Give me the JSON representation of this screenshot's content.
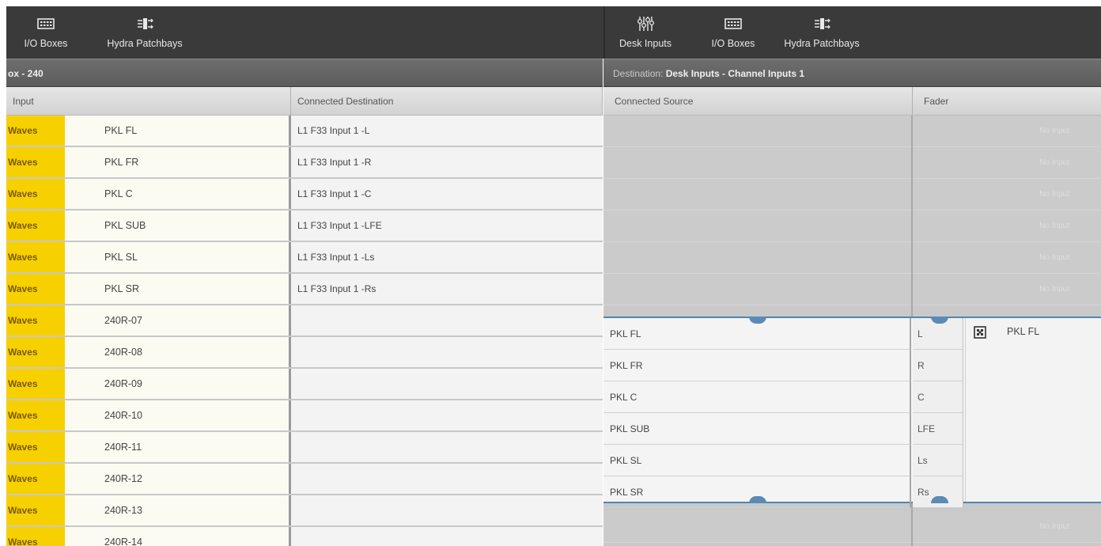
{
  "toolbar": {
    "left": {
      "io_boxes": {
        "label": "I/O Boxes",
        "icon": "io-box-icon"
      },
      "hydra_patchbays": {
        "label": "Hydra Patchbays",
        "icon": "patchbay-icon"
      }
    },
    "right": {
      "desk_inputs": {
        "label": "Desk Inputs",
        "icon": "faders-icon"
      },
      "io_boxes": {
        "label": "I/O Boxes",
        "icon": "io-box-icon"
      },
      "hydra_patchbays": {
        "label": "Hydra Patchbays",
        "icon": "patchbay-icon"
      }
    }
  },
  "source_panel": {
    "title": "ox - 240",
    "headers": {
      "input": "Input",
      "connected_destination": "Connected Destination"
    },
    "rows": [
      {
        "tag": "Waves",
        "input": "PKL FL",
        "destination": "L1 F33 Input 1 -L"
      },
      {
        "tag": "Waves",
        "input": "PKL FR",
        "destination": "L1 F33 Input 1 -R"
      },
      {
        "tag": "Waves",
        "input": "PKL C",
        "destination": "L1 F33 Input 1 -C"
      },
      {
        "tag": "Waves",
        "input": "PKL SUB",
        "destination": "L1 F33 Input 1 -LFE"
      },
      {
        "tag": "Waves",
        "input": "PKL SL",
        "destination": "L1 F33 Input 1 -Ls"
      },
      {
        "tag": "Waves",
        "input": "PKL SR",
        "destination": "L1 F33 Input 1 -Rs"
      },
      {
        "tag": "Waves",
        "input": "240R-07",
        "destination": ""
      },
      {
        "tag": "Waves",
        "input": "240R-08",
        "destination": ""
      },
      {
        "tag": "Waves",
        "input": "240R-09",
        "destination": ""
      },
      {
        "tag": "Waves",
        "input": "240R-10",
        "destination": ""
      },
      {
        "tag": "Waves",
        "input": "240R-11",
        "destination": ""
      },
      {
        "tag": "Waves",
        "input": "240R-12",
        "destination": ""
      },
      {
        "tag": "Waves",
        "input": "240R-13",
        "destination": ""
      },
      {
        "tag": "Waves",
        "input": "240R-14",
        "destination": ""
      }
    ]
  },
  "destination_panel": {
    "title_prefix": "Destination: ",
    "title": "Desk Inputs - Channel Inputs 1",
    "headers": {
      "connected_source": "Connected Source",
      "fader": "Fader"
    },
    "ghost_fader_text": "No Input",
    "active_rows": [
      {
        "source": "PKL FL",
        "leg": "L"
      },
      {
        "source": "PKL FR",
        "leg": "R"
      },
      {
        "source": "PKL C",
        "leg": "C"
      },
      {
        "source": "PKL SUB",
        "leg": "LFE"
      },
      {
        "source": "PKL SL",
        "leg": "Ls"
      },
      {
        "source": "PKL SR",
        "leg": "Rs"
      }
    ],
    "active_fader": {
      "name": "PKL FL",
      "icon": "multichannel-icon"
    }
  },
  "colors": {
    "waves_tag": "#f7d000",
    "selection_border": "#4f86b4",
    "toolbar_bg": "#3a3a3a"
  }
}
